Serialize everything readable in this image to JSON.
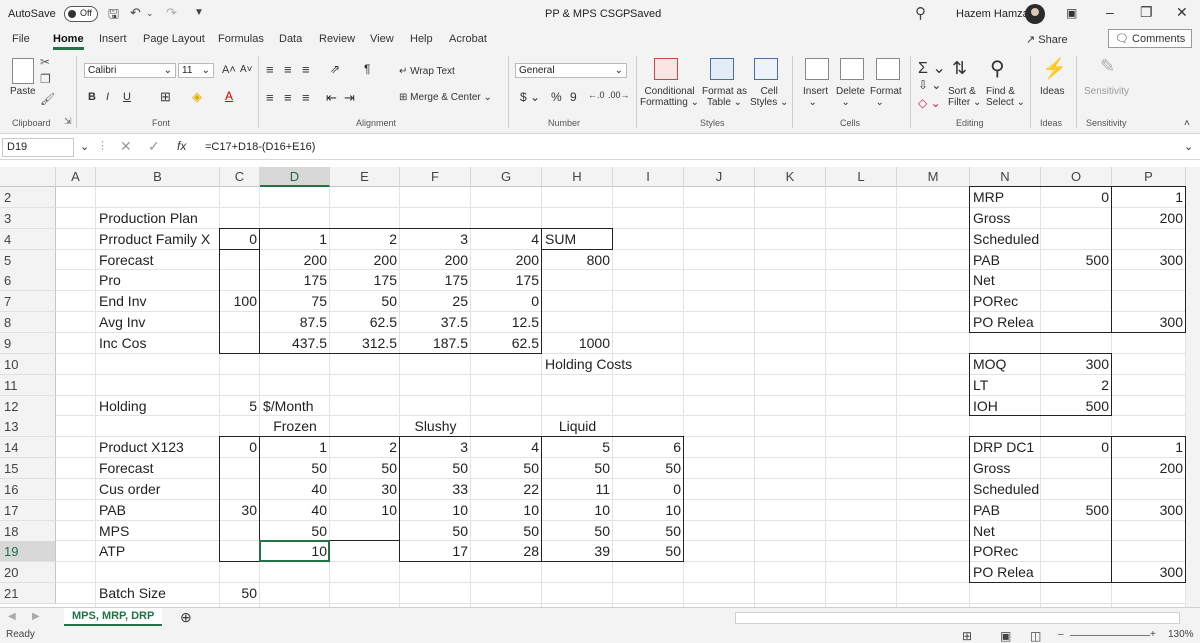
{
  "titlebar": {
    "autosave_label": "AutoSave",
    "autosave_state": "Off",
    "doc_title": "PP & MPS CSCP",
    "save_state": "Saved",
    "user_name": "Hazem Hamza"
  },
  "menu": {
    "tabs": [
      "File",
      "Home",
      "Insert",
      "Page Layout",
      "Formulas",
      "Data",
      "Review",
      "View",
      "Help",
      "Acrobat"
    ],
    "active": "Home",
    "share": "Share",
    "comments": "Comments"
  },
  "ribbon": {
    "paste": "Paste",
    "font_name": "Calibri",
    "font_size": "11",
    "wrap_text": "Wrap Text",
    "merge_center": "Merge & Center",
    "number_format": "General",
    "conditional_formatting": [
      "Conditional",
      "Formatting"
    ],
    "format_as_table": [
      "Format as",
      "Table"
    ],
    "cell_styles": [
      "Cell",
      "Styles"
    ],
    "insert": "Insert",
    "delete": "Delete",
    "format": "Format",
    "sort_filter": [
      "Sort &",
      "Filter"
    ],
    "find_select": [
      "Find &",
      "Select"
    ],
    "ideas": "Ideas",
    "sensitivity": "Sensitivity",
    "groups": {
      "clipboard": "Clipboard",
      "font": "Font",
      "alignment": "Alignment",
      "number": "Number",
      "styles": "Styles",
      "cells": "Cells",
      "editing": "Editing",
      "ideas": "Ideas",
      "sensitivity": "Sensitivity"
    }
  },
  "formula_bar": {
    "name_box": "D19",
    "formula": "=C17+D18-(D16+E16)"
  },
  "columns": [
    "A",
    "B",
    "C",
    "D",
    "E",
    "F",
    "G",
    "H",
    "I",
    "J",
    "K",
    "L",
    "M",
    "N",
    "O",
    "P"
  ],
  "rows": [
    "2",
    "3",
    "4",
    "5",
    "6",
    "7",
    "8",
    "9",
    "10",
    "11",
    "12",
    "13",
    "14",
    "15",
    "16",
    "17",
    "18",
    "19",
    "20",
    "21"
  ],
  "selected_cell": "D19",
  "cells": [
    {
      "ref": "B3",
      "value": "Production Plan",
      "align": "txt"
    },
    {
      "ref": "B4",
      "value": "Prroduct Family X",
      "align": "txt"
    },
    {
      "ref": "C4",
      "value": "0",
      "align": "num"
    },
    {
      "ref": "D4",
      "value": "1",
      "align": "num"
    },
    {
      "ref": "E4",
      "value": "2",
      "align": "num"
    },
    {
      "ref": "F4",
      "value": "3",
      "align": "num"
    },
    {
      "ref": "G4",
      "value": "4",
      "align": "num"
    },
    {
      "ref": "H4",
      "value": "SUM",
      "align": "txt"
    },
    {
      "ref": "B5",
      "value": "Forecast",
      "align": "txt"
    },
    {
      "ref": "D5",
      "value": "200",
      "align": "num"
    },
    {
      "ref": "E5",
      "value": "200",
      "align": "num"
    },
    {
      "ref": "F5",
      "value": "200",
      "align": "num"
    },
    {
      "ref": "G5",
      "value": "200",
      "align": "num"
    },
    {
      "ref": "H5",
      "value": "800",
      "align": "num"
    },
    {
      "ref": "B6",
      "value": "Pro",
      "align": "txt"
    },
    {
      "ref": "D6",
      "value": "175",
      "align": "num"
    },
    {
      "ref": "E6",
      "value": "175",
      "align": "num"
    },
    {
      "ref": "F6",
      "value": "175",
      "align": "num"
    },
    {
      "ref": "G6",
      "value": "175",
      "align": "num"
    },
    {
      "ref": "B7",
      "value": "End Inv",
      "align": "txt"
    },
    {
      "ref": "C7",
      "value": "100",
      "align": "num"
    },
    {
      "ref": "D7",
      "value": "75",
      "align": "num"
    },
    {
      "ref": "E7",
      "value": "50",
      "align": "num"
    },
    {
      "ref": "F7",
      "value": "25",
      "align": "num"
    },
    {
      "ref": "G7",
      "value": "0",
      "align": "num"
    },
    {
      "ref": "B8",
      "value": "Avg Inv",
      "align": "txt"
    },
    {
      "ref": "D8",
      "value": "87.5",
      "align": "num"
    },
    {
      "ref": "E8",
      "value": "62.5",
      "align": "num"
    },
    {
      "ref": "F8",
      "value": "37.5",
      "align": "num"
    },
    {
      "ref": "G8",
      "value": "12.5",
      "align": "num"
    },
    {
      "ref": "B9",
      "value": "Inc Cos",
      "align": "txt"
    },
    {
      "ref": "D9",
      "value": "437.5",
      "align": "num"
    },
    {
      "ref": "E9",
      "value": "312.5",
      "align": "num"
    },
    {
      "ref": "F9",
      "value": "187.5",
      "align": "num"
    },
    {
      "ref": "G9",
      "value": "62.5",
      "align": "num"
    },
    {
      "ref": "H9",
      "value": "1000",
      "align": "num"
    },
    {
      "ref": "H10",
      "value": "Holding Costs",
      "align": "txt"
    },
    {
      "ref": "B12",
      "value": "Holding",
      "align": "txt"
    },
    {
      "ref": "C12",
      "value": "5",
      "align": "num"
    },
    {
      "ref": "D12",
      "value": "$/Month",
      "align": "txt"
    },
    {
      "ref": "D13",
      "value": "Frozen",
      "align": "ctr"
    },
    {
      "ref": "F13",
      "value": "Slushy",
      "align": "ctr"
    },
    {
      "ref": "H13",
      "value": "Liquid",
      "align": "ctr"
    },
    {
      "ref": "B14",
      "value": "Product X123",
      "align": "txt"
    },
    {
      "ref": "C14",
      "value": "0",
      "align": "num"
    },
    {
      "ref": "D14",
      "value": "1",
      "align": "num"
    },
    {
      "ref": "E14",
      "value": "2",
      "align": "num"
    },
    {
      "ref": "F14",
      "value": "3",
      "align": "num"
    },
    {
      "ref": "G14",
      "value": "4",
      "align": "num"
    },
    {
      "ref": "H14",
      "value": "5",
      "align": "num"
    },
    {
      "ref": "I14",
      "value": "6",
      "align": "num"
    },
    {
      "ref": "B15",
      "value": "Forecast",
      "align": "txt"
    },
    {
      "ref": "D15",
      "value": "50",
      "align": "num"
    },
    {
      "ref": "E15",
      "value": "50",
      "align": "num"
    },
    {
      "ref": "F15",
      "value": "50",
      "align": "num"
    },
    {
      "ref": "G15",
      "value": "50",
      "align": "num"
    },
    {
      "ref": "H15",
      "value": "50",
      "align": "num"
    },
    {
      "ref": "I15",
      "value": "50",
      "align": "num"
    },
    {
      "ref": "B16",
      "value": "Cus order",
      "align": "txt"
    },
    {
      "ref": "D16",
      "value": "40",
      "align": "num"
    },
    {
      "ref": "E16",
      "value": "30",
      "align": "num"
    },
    {
      "ref": "F16",
      "value": "33",
      "align": "num"
    },
    {
      "ref": "G16",
      "value": "22",
      "align": "num"
    },
    {
      "ref": "H16",
      "value": "11",
      "align": "num"
    },
    {
      "ref": "I16",
      "value": "0",
      "align": "num"
    },
    {
      "ref": "B17",
      "value": "PAB",
      "align": "txt"
    },
    {
      "ref": "C17",
      "value": "30",
      "align": "num"
    },
    {
      "ref": "D17",
      "value": "40",
      "align": "num"
    },
    {
      "ref": "E17",
      "value": "10",
      "align": "num"
    },
    {
      "ref": "F17",
      "value": "10",
      "align": "num"
    },
    {
      "ref": "G17",
      "value": "10",
      "align": "num"
    },
    {
      "ref": "H17",
      "value": "10",
      "align": "num"
    },
    {
      "ref": "I17",
      "value": "10",
      "align": "num"
    },
    {
      "ref": "B18",
      "value": "MPS",
      "align": "txt"
    },
    {
      "ref": "D18",
      "value": "50",
      "align": "num"
    },
    {
      "ref": "F18",
      "value": "50",
      "align": "num"
    },
    {
      "ref": "G18",
      "value": "50",
      "align": "num"
    },
    {
      "ref": "H18",
      "value": "50",
      "align": "num"
    },
    {
      "ref": "I18",
      "value": "50",
      "align": "num"
    },
    {
      "ref": "B19",
      "value": "ATP",
      "align": "txt"
    },
    {
      "ref": "D19",
      "value": "10",
      "align": "num"
    },
    {
      "ref": "F19",
      "value": "17",
      "align": "num"
    },
    {
      "ref": "G19",
      "value": "28",
      "align": "num"
    },
    {
      "ref": "H19",
      "value": "39",
      "align": "num"
    },
    {
      "ref": "I19",
      "value": "50",
      "align": "num"
    },
    {
      "ref": "B21",
      "value": "Batch Size",
      "align": "txt"
    },
    {
      "ref": "C21",
      "value": "50",
      "align": "num"
    },
    {
      "ref": "N2",
      "value": "MRP",
      "align": "txt"
    },
    {
      "ref": "O2",
      "value": "0",
      "align": "num"
    },
    {
      "ref": "P2",
      "value": "1",
      "align": "num"
    },
    {
      "ref": "N3",
      "value": "Gross",
      "align": "txt"
    },
    {
      "ref": "P3",
      "value": "200",
      "align": "num"
    },
    {
      "ref": "N4",
      "value": "Scheduled",
      "align": "txt"
    },
    {
      "ref": "N5",
      "value": "PAB",
      "align": "txt"
    },
    {
      "ref": "O5",
      "value": "500",
      "align": "num"
    },
    {
      "ref": "P5",
      "value": "300",
      "align": "num"
    },
    {
      "ref": "N6",
      "value": "Net",
      "align": "txt"
    },
    {
      "ref": "N7",
      "value": "PORec",
      "align": "txt"
    },
    {
      "ref": "N8",
      "value": "PO Relea",
      "align": "txt"
    },
    {
      "ref": "P8",
      "value": "300",
      "align": "num"
    },
    {
      "ref": "N10",
      "value": "MOQ",
      "align": "txt"
    },
    {
      "ref": "O10",
      "value": "300",
      "align": "num"
    },
    {
      "ref": "N11",
      "value": "LT",
      "align": "txt"
    },
    {
      "ref": "O11",
      "value": "2",
      "align": "num"
    },
    {
      "ref": "N12",
      "value": "IOH",
      "align": "txt"
    },
    {
      "ref": "O12",
      "value": "500",
      "align": "num"
    },
    {
      "ref": "N14",
      "value": "DRP DC1",
      "align": "txt"
    },
    {
      "ref": "O14",
      "value": "0",
      "align": "num"
    },
    {
      "ref": "P14",
      "value": "1",
      "align": "num"
    },
    {
      "ref": "N15",
      "value": "Gross",
      "align": "txt"
    },
    {
      "ref": "P15",
      "value": "200",
      "align": "num"
    },
    {
      "ref": "N16",
      "value": "Scheduled",
      "align": "txt"
    },
    {
      "ref": "N17",
      "value": "PAB",
      "align": "txt"
    },
    {
      "ref": "O17",
      "value": "500",
      "align": "num"
    },
    {
      "ref": "P17",
      "value": "300",
      "align": "num"
    },
    {
      "ref": "N18",
      "value": "Net",
      "align": "txt"
    },
    {
      "ref": "N19",
      "value": "PORec",
      "align": "txt"
    },
    {
      "ref": "N20",
      "value": "PO Relea",
      "align": "txt"
    },
    {
      "ref": "P20",
      "value": "300",
      "align": "num"
    }
  ],
  "sheets": {
    "active": "MPS, MRP, DRP"
  },
  "status": {
    "state": "Ready",
    "zoom": "130%"
  },
  "colors": {
    "accent": "#217346",
    "ribbon_bg": "#f3f3f3"
  },
  "icons": [
    "undo-icon",
    "redo-icon",
    "save-icon",
    "search-icon",
    "paste-icon",
    "bold-icon",
    "italic-icon",
    "underline-icon",
    "sort-filter-icon",
    "find-icon",
    "ideas-icon",
    "add-sheet-icon",
    "close-icon"
  ]
}
